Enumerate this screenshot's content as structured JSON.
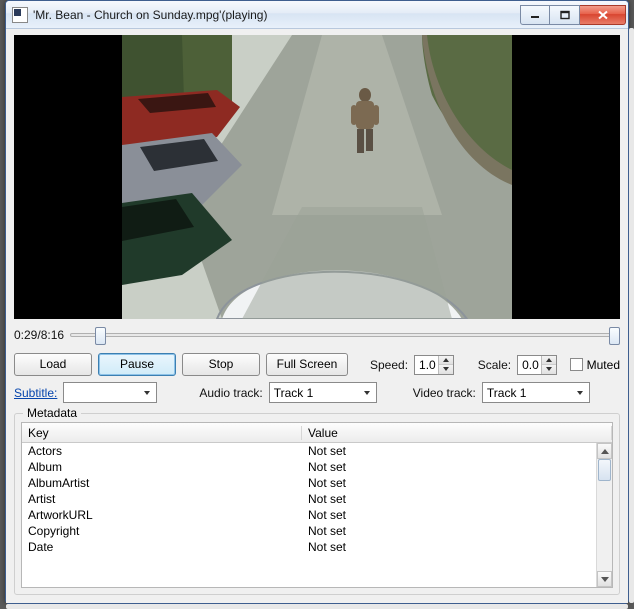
{
  "window": {
    "title": "'Mr. Bean - Church on Sunday.mpg'(playing)"
  },
  "playback": {
    "current": "0:29",
    "total": "8:16"
  },
  "buttons": {
    "load": "Load",
    "pause": "Pause",
    "stop": "Stop",
    "fullscreen": "Full Screen"
  },
  "speed": {
    "label": "Speed:",
    "value": "1.0"
  },
  "scale": {
    "label": "Scale:",
    "value": "0.0"
  },
  "muted": {
    "label": "Muted"
  },
  "subtitle": {
    "label": "Subtitle:",
    "value": ""
  },
  "audio_track": {
    "label": "Audio track:",
    "value": "Track 1"
  },
  "video_track": {
    "label": "Video track:",
    "value": "Track 1"
  },
  "metadata": {
    "title": "Metadata",
    "col_key": "Key",
    "col_val": "Value",
    "rows": [
      {
        "k": "Actors",
        "v": "Not set"
      },
      {
        "k": "Album",
        "v": "Not set"
      },
      {
        "k": "AlbumArtist",
        "v": "Not set"
      },
      {
        "k": "Artist",
        "v": "Not set"
      },
      {
        "k": "ArtworkURL",
        "v": "Not set"
      },
      {
        "k": "Copyright",
        "v": "Not set"
      },
      {
        "k": "Date",
        "v": "Not set"
      }
    ]
  }
}
